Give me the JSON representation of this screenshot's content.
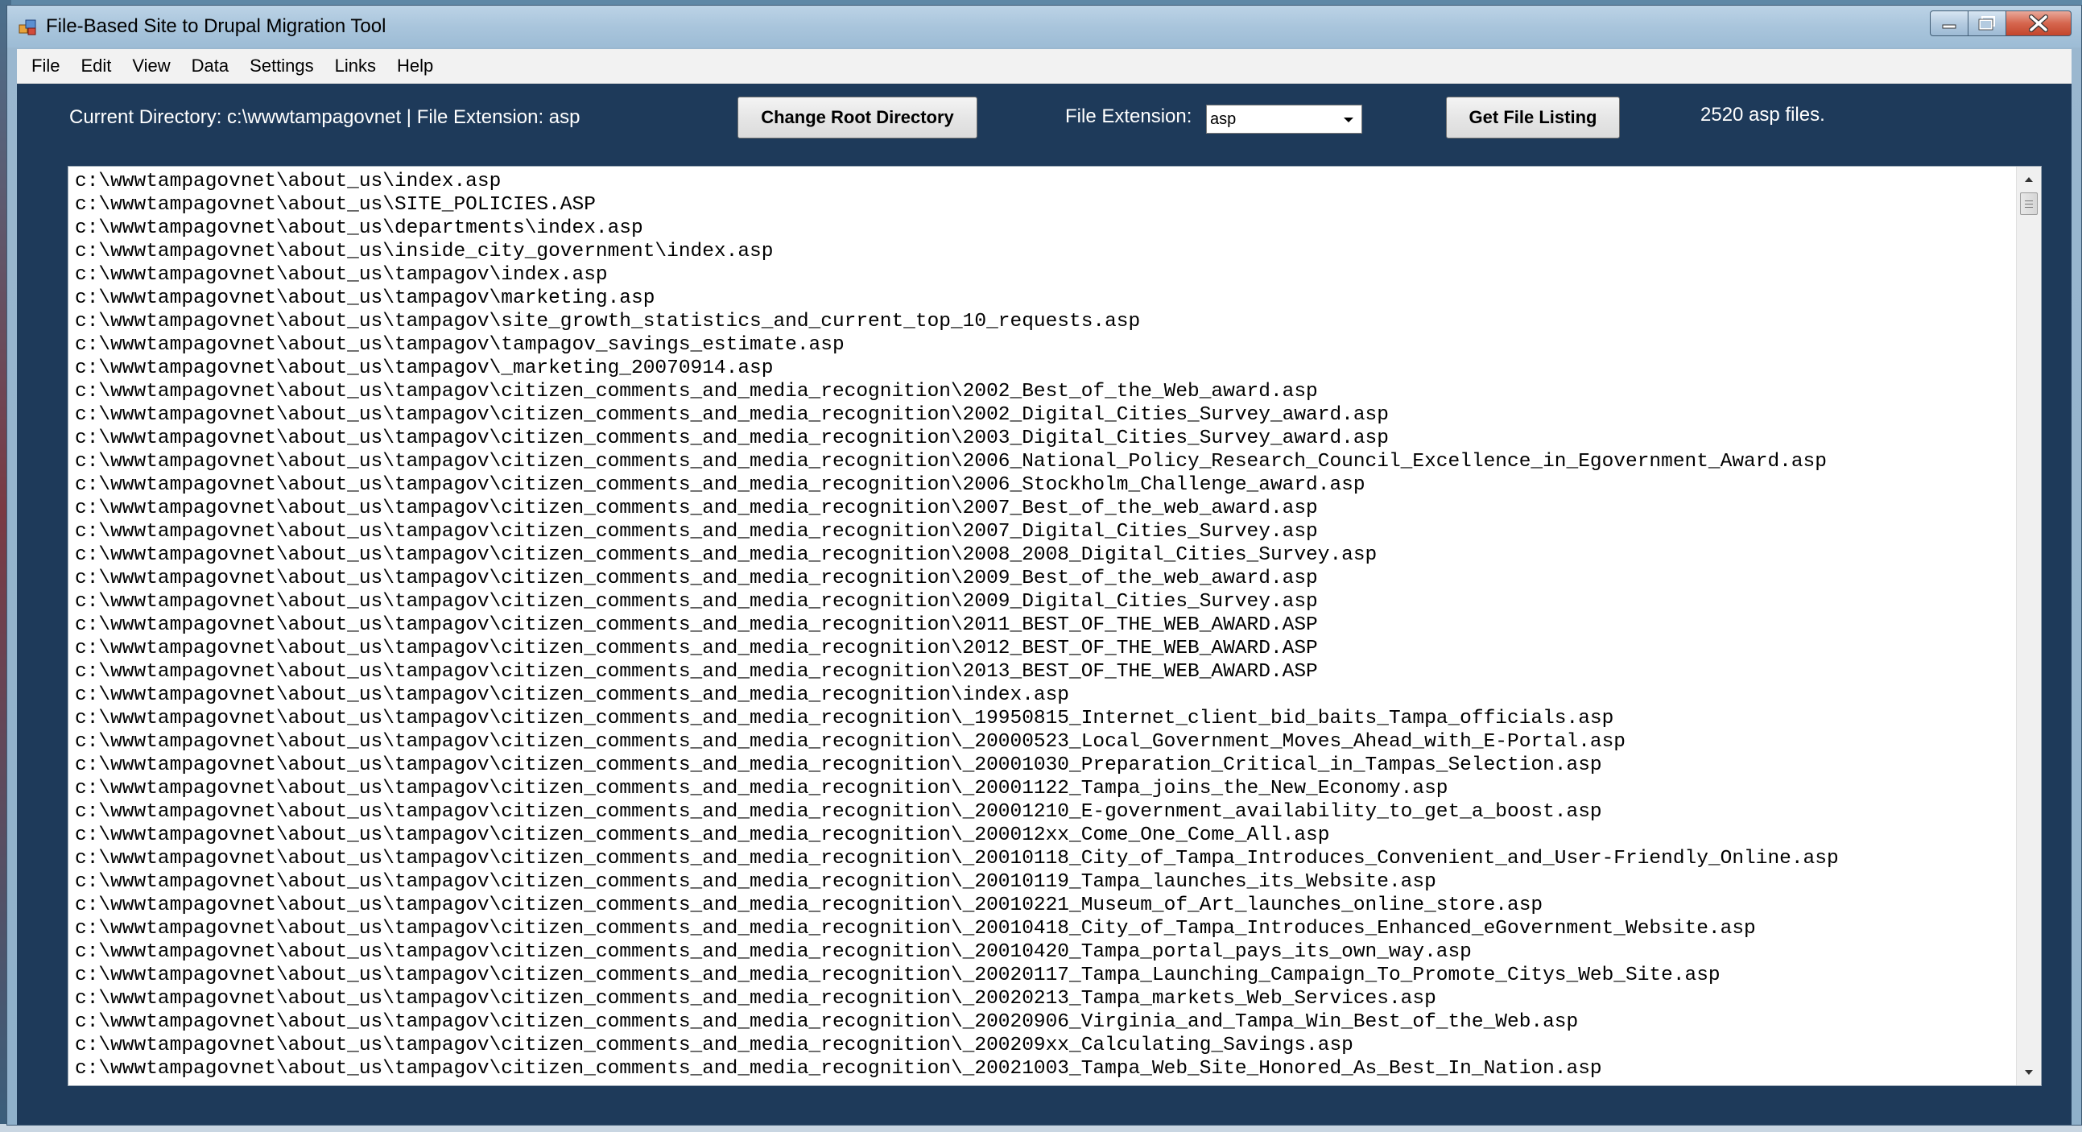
{
  "window": {
    "title": "File-Based Site to Drupal Migration Tool"
  },
  "menu": [
    "File",
    "Edit",
    "View",
    "Data",
    "Settings",
    "Links",
    "Help"
  ],
  "toolbar": {
    "status_text": "Current Directory: c:\\wwwtampagovnet  |  File Extension: asp",
    "change_root_label": "Change Root Directory",
    "file_extension_label": "File Extension:",
    "file_extension_value": "asp",
    "get_listing_label": "Get File Listing",
    "file_count_text": "2520 asp files."
  },
  "file_list": [
    "c:\\wwwtampagovnet\\about_us\\index.asp",
    "c:\\wwwtampagovnet\\about_us\\SITE_POLICIES.ASP",
    "c:\\wwwtampagovnet\\about_us\\departments\\index.asp",
    "c:\\wwwtampagovnet\\about_us\\inside_city_government\\index.asp",
    "c:\\wwwtampagovnet\\about_us\\tampagov\\index.asp",
    "c:\\wwwtampagovnet\\about_us\\tampagov\\marketing.asp",
    "c:\\wwwtampagovnet\\about_us\\tampagov\\site_growth_statistics_and_current_top_10_requests.asp",
    "c:\\wwwtampagovnet\\about_us\\tampagov\\tampagov_savings_estimate.asp",
    "c:\\wwwtampagovnet\\about_us\\tampagov\\_marketing_20070914.asp",
    "c:\\wwwtampagovnet\\about_us\\tampagov\\citizen_comments_and_media_recognition\\2002_Best_of_the_Web_award.asp",
    "c:\\wwwtampagovnet\\about_us\\tampagov\\citizen_comments_and_media_recognition\\2002_Digital_Cities_Survey_award.asp",
    "c:\\wwwtampagovnet\\about_us\\tampagov\\citizen_comments_and_media_recognition\\2003_Digital_Cities_Survey_award.asp",
    "c:\\wwwtampagovnet\\about_us\\tampagov\\citizen_comments_and_media_recognition\\2006_National_Policy_Research_Council_Excellence_in_Egovernment_Award.asp",
    "c:\\wwwtampagovnet\\about_us\\tampagov\\citizen_comments_and_media_recognition\\2006_Stockholm_Challenge_award.asp",
    "c:\\wwwtampagovnet\\about_us\\tampagov\\citizen_comments_and_media_recognition\\2007_Best_of_the_web_award.asp",
    "c:\\wwwtampagovnet\\about_us\\tampagov\\citizen_comments_and_media_recognition\\2007_Digital_Cities_Survey.asp",
    "c:\\wwwtampagovnet\\about_us\\tampagov\\citizen_comments_and_media_recognition\\2008_2008_Digital_Cities_Survey.asp",
    "c:\\wwwtampagovnet\\about_us\\tampagov\\citizen_comments_and_media_recognition\\2009_Best_of_the_web_award.asp",
    "c:\\wwwtampagovnet\\about_us\\tampagov\\citizen_comments_and_media_recognition\\2009_Digital_Cities_Survey.asp",
    "c:\\wwwtampagovnet\\about_us\\tampagov\\citizen_comments_and_media_recognition\\2011_BEST_OF_THE_WEB_AWARD.ASP",
    "c:\\wwwtampagovnet\\about_us\\tampagov\\citizen_comments_and_media_recognition\\2012_BEST_OF_THE_WEB_AWARD.ASP",
    "c:\\wwwtampagovnet\\about_us\\tampagov\\citizen_comments_and_media_recognition\\2013_BEST_OF_THE_WEB_AWARD.ASP",
    "c:\\wwwtampagovnet\\about_us\\tampagov\\citizen_comments_and_media_recognition\\index.asp",
    "c:\\wwwtampagovnet\\about_us\\tampagov\\citizen_comments_and_media_recognition\\_19950815_Internet_client_bid_baits_Tampa_officials.asp",
    "c:\\wwwtampagovnet\\about_us\\tampagov\\citizen_comments_and_media_recognition\\_20000523_Local_Government_Moves_Ahead_with_E-Portal.asp",
    "c:\\wwwtampagovnet\\about_us\\tampagov\\citizen_comments_and_media_recognition\\_20001030_Preparation_Critical_in_Tampas_Selection.asp",
    "c:\\wwwtampagovnet\\about_us\\tampagov\\citizen_comments_and_media_recognition\\_20001122_Tampa_joins_the_New_Economy.asp",
    "c:\\wwwtampagovnet\\about_us\\tampagov\\citizen_comments_and_media_recognition\\_20001210_E-government_availability_to_get_a_boost.asp",
    "c:\\wwwtampagovnet\\about_us\\tampagov\\citizen_comments_and_media_recognition\\_200012xx_Come_One_Come_All.asp",
    "c:\\wwwtampagovnet\\about_us\\tampagov\\citizen_comments_and_media_recognition\\_20010118_City_of_Tampa_Introduces_Convenient_and_User-Friendly_Online.asp",
    "c:\\wwwtampagovnet\\about_us\\tampagov\\citizen_comments_and_media_recognition\\_20010119_Tampa_launches_its_Website.asp",
    "c:\\wwwtampagovnet\\about_us\\tampagov\\citizen_comments_and_media_recognition\\_20010221_Museum_of_Art_launches_online_store.asp",
    "c:\\wwwtampagovnet\\about_us\\tampagov\\citizen_comments_and_media_recognition\\_20010418_City_of_Tampa_Introduces_Enhanced_eGovernment_Website.asp",
    "c:\\wwwtampagovnet\\about_us\\tampagov\\citizen_comments_and_media_recognition\\_20010420_Tampa_portal_pays_its_own_way.asp",
    "c:\\wwwtampagovnet\\about_us\\tampagov\\citizen_comments_and_media_recognition\\_20020117_Tampa_Launching_Campaign_To_Promote_Citys_Web_Site.asp",
    "c:\\wwwtampagovnet\\about_us\\tampagov\\citizen_comments_and_media_recognition\\_20020213_Tampa_markets_Web_Services.asp",
    "c:\\wwwtampagovnet\\about_us\\tampagov\\citizen_comments_and_media_recognition\\_20020906_Virginia_and_Tampa_Win_Best_of_the_Web.asp",
    "c:\\wwwtampagovnet\\about_us\\tampagov\\citizen_comments_and_media_recognition\\_200209xx_Calculating_Savings.asp",
    "c:\\wwwtampagovnet\\about_us\\tampagov\\citizen_comments_and_media_recognition\\_20021003_Tampa_Web_Site_Honored_As_Best_In_Nation.asp"
  ],
  "colors": {
    "client_background": "#1e3a5a",
    "title_bar": "#a9c5dc",
    "close_button": "#c3452c"
  },
  "icons": [
    "app-icon",
    "minimize-icon",
    "maximize-icon",
    "close-icon",
    "dropdown-arrow-icon",
    "scroll-up-icon",
    "scroll-down-icon"
  ]
}
